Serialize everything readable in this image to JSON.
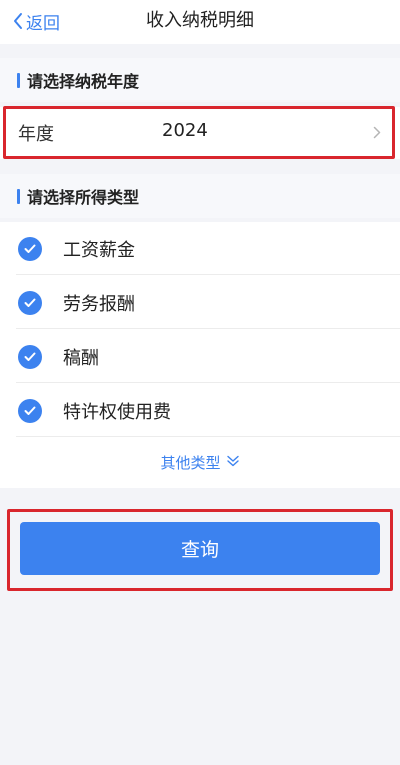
{
  "nav": {
    "back_label": "返回",
    "title": "收入纳税明细"
  },
  "year_section": {
    "heading": "请选择纳税年度",
    "label": "年度",
    "value": "2024"
  },
  "type_section": {
    "heading": "请选择所得类型",
    "items": [
      {
        "label": "工资薪金",
        "checked": true
      },
      {
        "label": "劳务报酬",
        "checked": true
      },
      {
        "label": "稿酬",
        "checked": true
      },
      {
        "label": "特许权使用费",
        "checked": true
      }
    ],
    "more_label": "其他类型"
  },
  "query_button_label": "查询",
  "colors": {
    "accent": "#3c82ef",
    "highlight": "#d9262d"
  }
}
